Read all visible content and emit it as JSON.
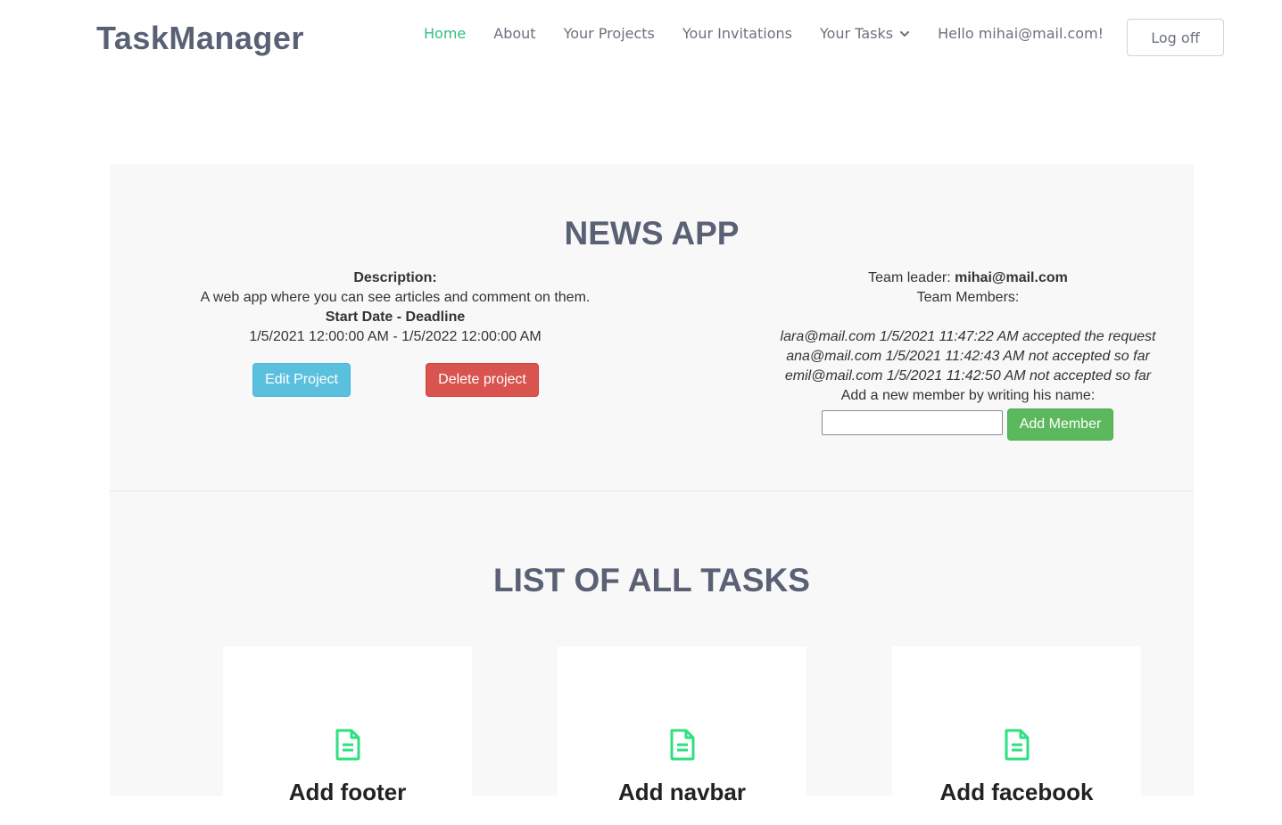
{
  "header": {
    "logo": "TaskManager",
    "nav": {
      "home": "Home",
      "about": "About",
      "projects": "Your Projects",
      "invitations": "Your Invitations",
      "tasks": "Your Tasks",
      "greeting": "Hello mihai@mail.com!"
    },
    "logoff": "Log off"
  },
  "project": {
    "title": "NEWS APP",
    "description_label": "Description:",
    "description": "A web app where you can see articles and comment on them.",
    "dates_label": "Start Date - Deadline",
    "dates": "1/5/2021 12:00:00 AM - 1/5/2022 12:00:00 AM",
    "edit_label": "Edit Project",
    "delete_label": "Delete project",
    "team_leader_label": "Team leader: ",
    "team_leader": "mihai@mail.com",
    "members_label": "Team Members:",
    "members": [
      "lara@mail.com 1/5/2021 11:47:22 AM accepted the request",
      "ana@mail.com 1/5/2021 11:42:43 AM not accepted so far",
      "emil@mail.com 1/5/2021 11:42:50 AM not accepted so far"
    ],
    "add_member_prompt": "Add a new member by writing his name:",
    "add_member_value": "",
    "add_member_button": "Add Member"
  },
  "tasks": {
    "title": "LIST OF ALL TASKS",
    "items": [
      {
        "name": "Add footer"
      },
      {
        "name": "Add navbar"
      },
      {
        "name": "Add facebook"
      }
    ]
  },
  "colors": {
    "accent": "#2fc17c",
    "heading": "#5a6174",
    "info": "#5bc0de",
    "danger": "#d9534f",
    "success": "#5cb85c",
    "icon": "#2ee07f"
  },
  "icons": {
    "dropdown": "chevron-down-icon",
    "task": "file-document-icon"
  }
}
